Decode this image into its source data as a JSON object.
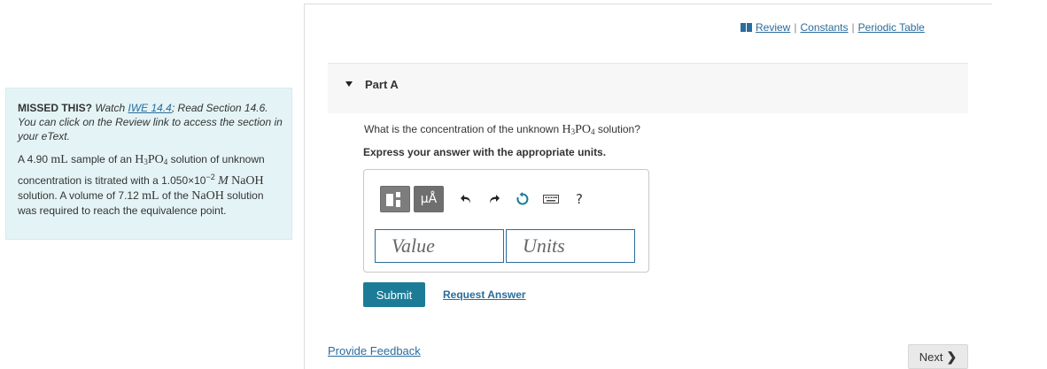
{
  "left_panel": {
    "missed_label": "MISSED THIS?",
    "watch_text": "Watch",
    "iwe_link": "IWE 14.4",
    "read_text": "; Read Section 14.6. You can click on the Review link to access the section in your eText.",
    "problem": {
      "p1": "A 4.90",
      "u_ml": "mL",
      "p2": "sample of an",
      "h": "H",
      "h_sub": "3",
      "po": "PO",
      "po_sub": "4",
      "p3": "solution of unknown concentration is titrated with a",
      "conc_mantissa": "1.050×10",
      "conc_exp": "−2",
      "m": "M",
      "naoh": "NaOH",
      "p4": "solution. A volume of 7.12",
      "u_ml2": "mL",
      "p5": "of the",
      "naoh2": "NaOH",
      "p6": "solution was required to reach the equivalence point."
    }
  },
  "review_links": {
    "review": "Review",
    "constants": "Constants",
    "periodic_table": "Periodic Table",
    "sep": "|"
  },
  "part": {
    "title": "Part A",
    "question_pre": "What is the concentration of the unknown",
    "question_post": "solution?",
    "formula_h": "H",
    "formula_h_sub": "3",
    "formula_po": "PO",
    "formula_po_sub": "4",
    "instruction": "Express your answer with the appropriate units."
  },
  "toolbar": {
    "units_label": "μÅ",
    "help_label": "?",
    "icons": [
      "templates-icon",
      "units-icon",
      "undo-icon",
      "redo-icon",
      "reset-icon",
      "keyboard-icon",
      "help-icon"
    ]
  },
  "answer": {
    "value_placeholder": "Value",
    "units_placeholder": "Units"
  },
  "actions": {
    "submit": "Submit",
    "request_answer": "Request Answer",
    "provide_feedback": "Provide Feedback",
    "next": "Next"
  },
  "colors": {
    "accent": "#1c7c97",
    "link": "#2a6c9c",
    "info_bg": "#e4f4f6"
  }
}
